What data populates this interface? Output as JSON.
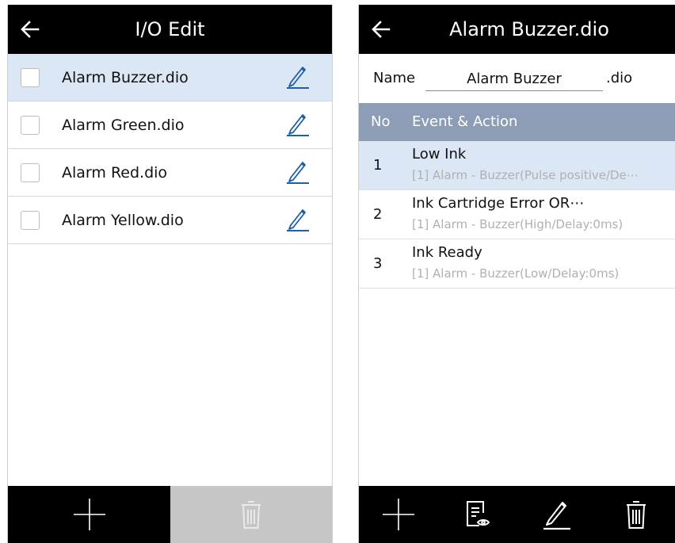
{
  "left": {
    "header": {
      "title": "I/O Edit",
      "back_icon": "arrow-left-icon"
    },
    "files": [
      {
        "name": "Alarm Buzzer.dio",
        "checked": false,
        "selected": true
      },
      {
        "name": "Alarm Green.dio",
        "checked": false,
        "selected": false
      },
      {
        "name": "Alarm Red.dio",
        "checked": false,
        "selected": false
      },
      {
        "name": "Alarm Yellow.dio",
        "checked": false,
        "selected": false
      }
    ],
    "footer": {
      "add_icon": "plus-icon",
      "delete_icon": "trash-icon",
      "delete_enabled": false
    }
  },
  "right": {
    "header": {
      "title": "Alarm Buzzer.dio",
      "back_icon": "arrow-left-icon"
    },
    "name_label": "Name",
    "name_value": "Alarm Buzzer",
    "extension": ".dio",
    "table": {
      "col_no": "No",
      "col_event": "Event & Action",
      "rows": [
        {
          "no": "1",
          "event": "Low Ink",
          "action": "[1] Alarm - Buzzer(Pulse positive/De⋯",
          "selected": true
        },
        {
          "no": "2",
          "event": "Ink Cartridge Error OR⋯",
          "action": "[1] Alarm - Buzzer(High/Delay:0ms)",
          "selected": false
        },
        {
          "no": "3",
          "event": "Ink Ready",
          "action": "[1] Alarm - Buzzer(Low/Delay:0ms)",
          "selected": false
        }
      ]
    },
    "footer": {
      "icons": [
        "plus-icon",
        "document-view-icon",
        "pencil-icon",
        "trash-icon"
      ]
    }
  },
  "colors": {
    "header": "#000000",
    "selected_row": "#dbe7f4",
    "table_header": "#8c9db5",
    "accent_pencil": "#1f5fa8",
    "disabled": "#c6c6c6"
  }
}
